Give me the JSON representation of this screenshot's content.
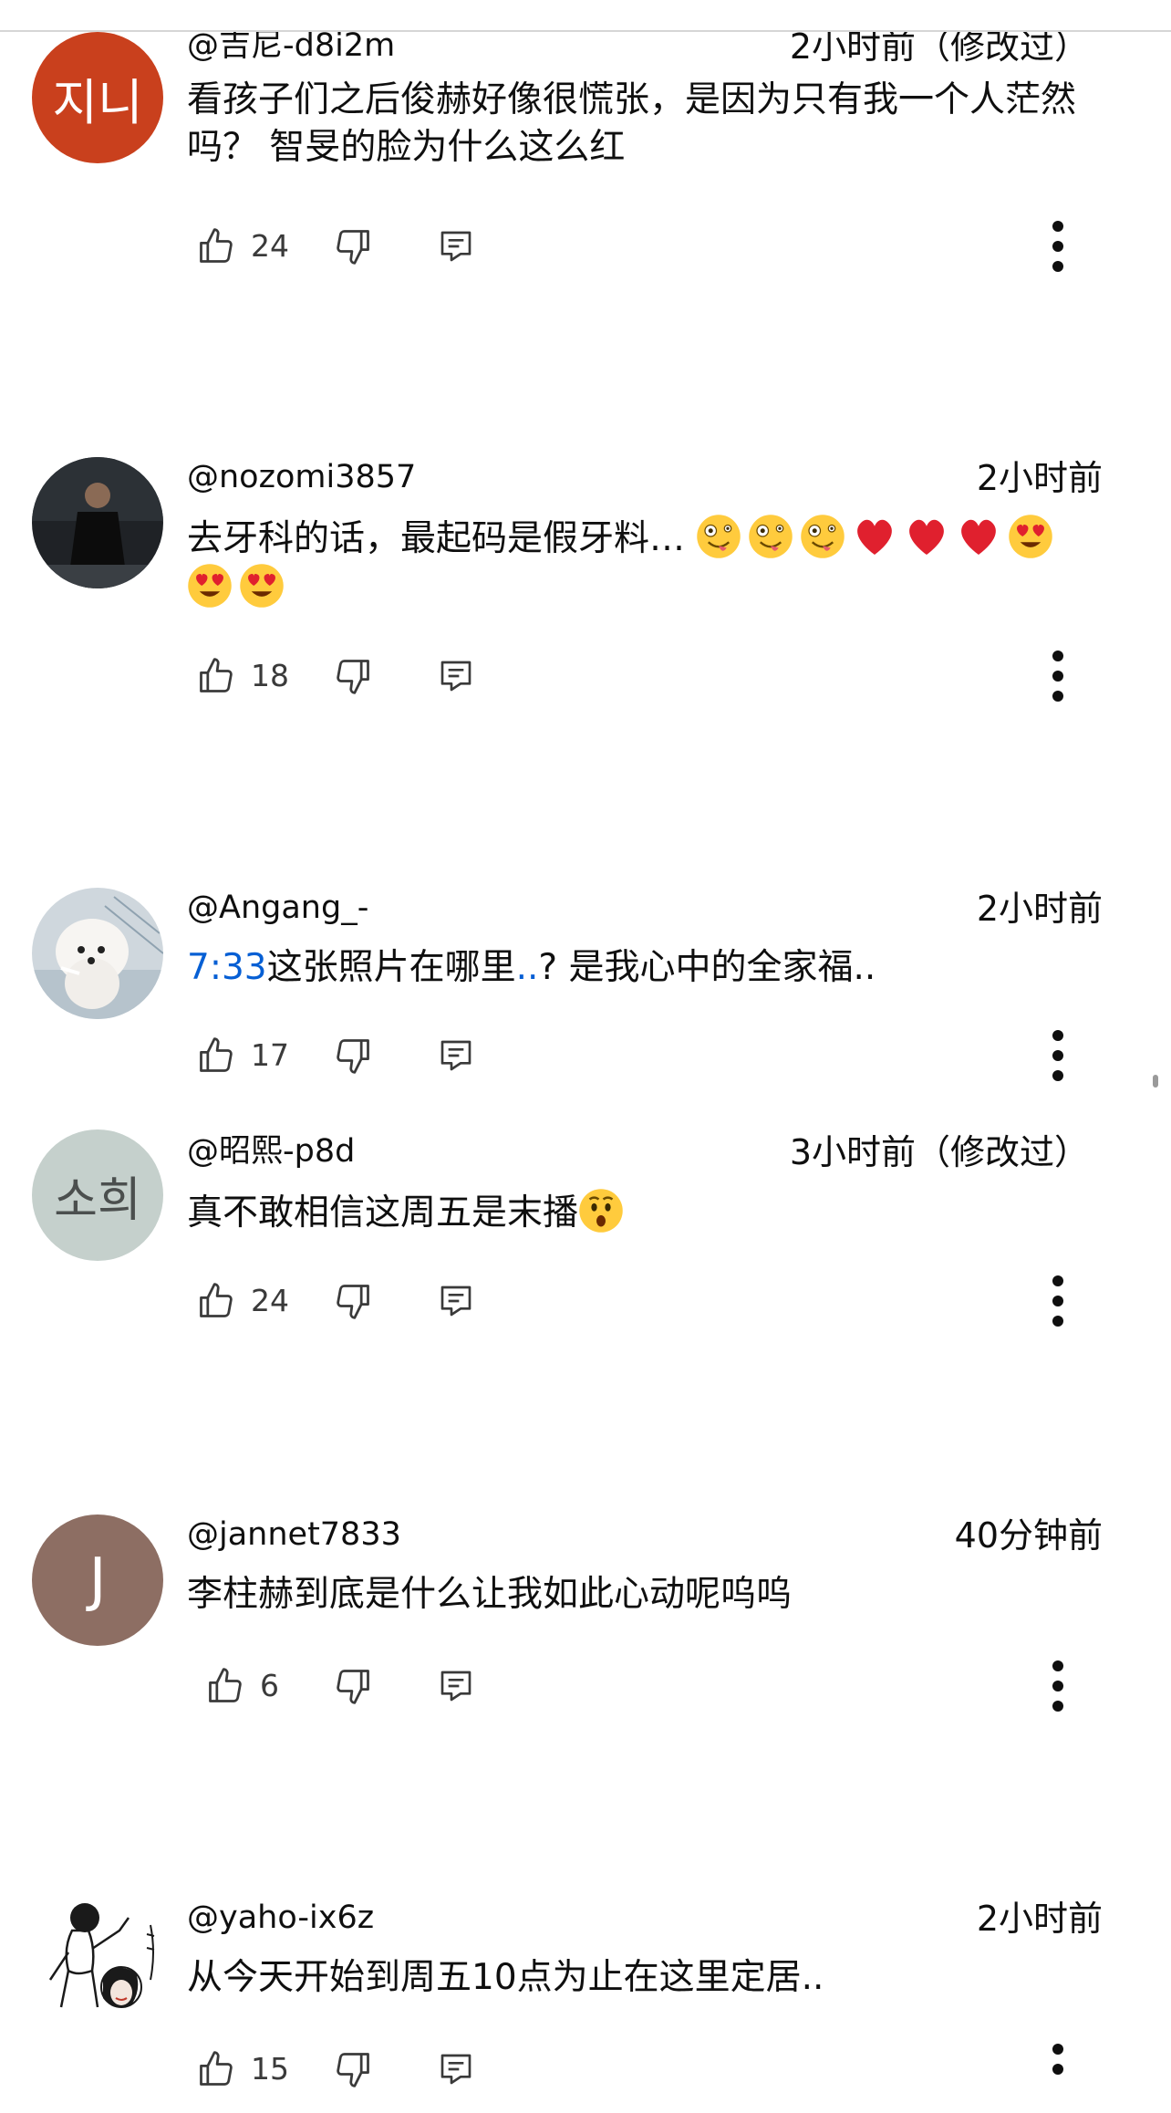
{
  "comments": [
    {
      "author": "@吉尼-d8i2m",
      "time": "2小时前（修改过）",
      "text": "看孩子们之后俊赫好像很慌张，是因为只有我一个人茫然吗？ 智旻的脸为什么这么红",
      "likes": "24",
      "avatar": {
        "type": "letter",
        "letter": "지니",
        "color": "#c9401d"
      }
    },
    {
      "author": "@nozomi3857",
      "time": "2小时前",
      "text": "去牙科的话，最起码是假牙料…",
      "emojis": [
        "crazy-face",
        "crazy-face",
        "crazy-face",
        "red-heart",
        "red-heart",
        "red-heart",
        "heart-eyes",
        "heart-eyes",
        "heart-eyes"
      ],
      "likes": "18",
      "avatar": {
        "type": "photo",
        "subject": "person-in-black"
      }
    },
    {
      "author": "@Angang_-",
      "time": "2小时前",
      "timestamp_link": "7:33",
      "text_a": "这张照片在哪里",
      "text_link_dots": "..",
      "text_b": "? 是我心中的全家福..",
      "likes": "17",
      "avatar": {
        "type": "photo",
        "subject": "white-puppy"
      }
    },
    {
      "author": "@昭熙-p8d",
      "time": "3小时前（修改过）",
      "text": "真不敢相信这周五是末播",
      "emojis": [
        "hushed-face"
      ],
      "likes": "24",
      "avatar": {
        "type": "letter",
        "letter": "소희",
        "color": "#c5d0cc"
      }
    },
    {
      "author": "@jannet7833",
      "time": "40分钟前",
      "text": "李柱赫到底是什么让我如此心动呢呜呜",
      "likes": "6",
      "avatar": {
        "type": "letter",
        "letter": "J",
        "color": "#8d6e63"
      }
    },
    {
      "author": "@yaho-ix6z",
      "time": "2小时前",
      "text": "从今天开始到周五10点为止在这里定居..",
      "likes": "15",
      "avatar": {
        "type": "drawing",
        "subject": "sketch-illustration"
      }
    }
  ],
  "icons": {
    "like": "thumbs-up-icon",
    "dislike": "thumbs-down-icon",
    "reply": "reply-comment-icon",
    "more": "more-vertical-icon"
  }
}
